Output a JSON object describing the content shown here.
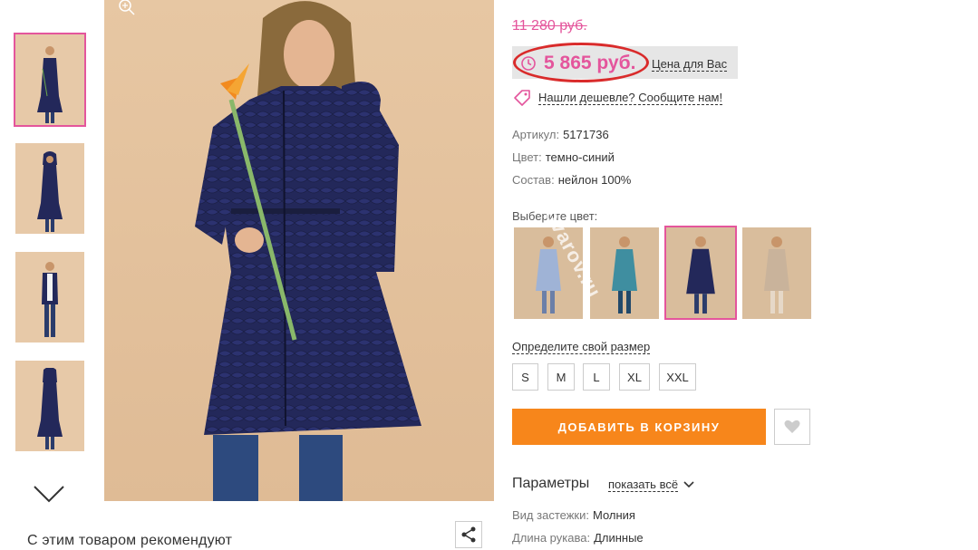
{
  "thumbnails": [
    {
      "label": "thumb-1",
      "active": true
    },
    {
      "label": "thumb-2",
      "active": false
    },
    {
      "label": "thumb-3",
      "active": false
    },
    {
      "label": "thumb-4",
      "active": false
    }
  ],
  "main": {
    "recommend_title": "С этим товаром рекомендуют"
  },
  "product": {
    "old_price": "11 280 руб.",
    "price": "5 865 руб.",
    "price_note": "Цена для Вас",
    "cheaper_link": "Нашли дешевле? Сообщите нам!",
    "attributes": [
      {
        "label": "Артикул:",
        "value": "5171736"
      },
      {
        "label": "Цвет:",
        "value": "темно-синий"
      },
      {
        "label": "Состав:",
        "value": "нейлон 100%"
      }
    ],
    "choose_color_label": "Выберите цвет:",
    "watermark": "ovarov.ru",
    "color_swatches": [
      {
        "name": "light-blue",
        "active": false
      },
      {
        "name": "teal",
        "active": false
      },
      {
        "name": "dark-blue",
        "active": true
      },
      {
        "name": "beige",
        "active": false
      }
    ],
    "size_link": "Определите свой размер",
    "sizes": [
      "S",
      "M",
      "L",
      "XL",
      "XXL"
    ],
    "add_to_cart": "ДОБАВИТЬ В КОРЗИНУ",
    "params_title": "Параметры",
    "show_all": "показать всё",
    "params": [
      {
        "label": "Вид застежки:",
        "value": "Молния"
      },
      {
        "label": "Длина рукава:",
        "value": "Длинные"
      }
    ]
  },
  "colors": {
    "accent_pink": "#e4559c",
    "cart_orange": "#f7861b",
    "highlight_red": "#d92b2b",
    "coat_navy": "#23285a"
  }
}
